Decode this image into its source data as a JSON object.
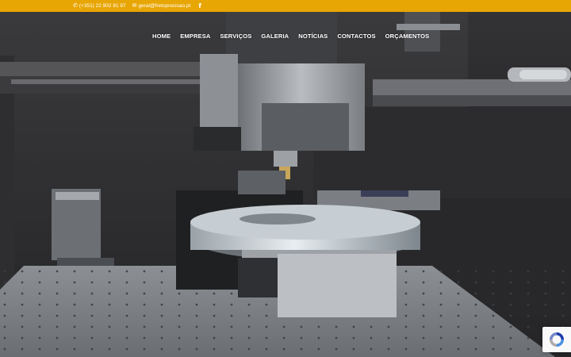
{
  "topbar": {
    "phone": "(+351) 22 902 81 97",
    "email": "geral@fretoprecisao.pt",
    "phone_icon": "phone-icon",
    "email_icon": "envelope-icon",
    "social_icon": "facebook-icon",
    "background_color": "#e8a605"
  },
  "nav": {
    "items": [
      {
        "label": "HOME"
      },
      {
        "label": "EMPRESA"
      },
      {
        "label": "SERVIÇOS"
      },
      {
        "label": "GALERIA"
      },
      {
        "label": "NOTÍCIAS"
      },
      {
        "label": "CONTACTOS"
      },
      {
        "label": "ORÇAMENTOS"
      }
    ]
  },
  "hero": {
    "image_icon": "cnc-machine-render-icon"
  },
  "recaptcha": {
    "icon": "recaptcha-icon"
  }
}
